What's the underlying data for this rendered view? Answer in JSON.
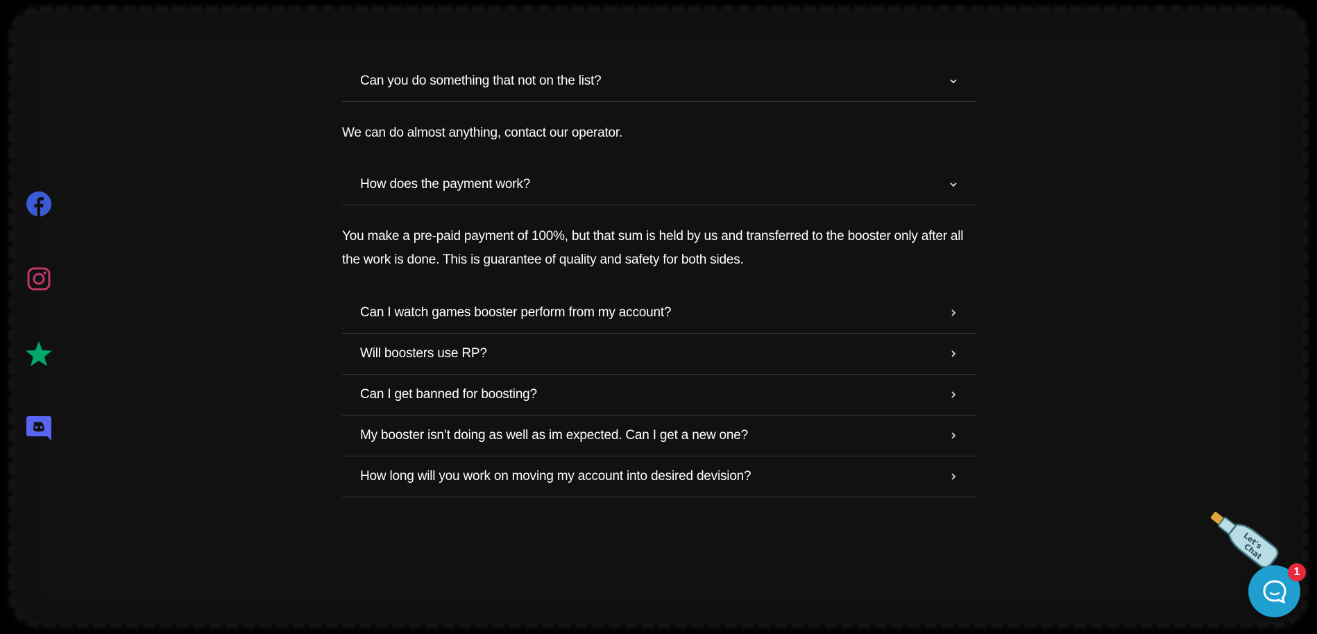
{
  "social": [
    {
      "name": "facebook",
      "icon": "facebook-icon",
      "color": "#3b5bd6"
    },
    {
      "name": "instagram",
      "icon": "instagram-icon",
      "color": "#c2366e"
    },
    {
      "name": "trustpilot",
      "icon": "star-icon",
      "color": "#00a86b"
    },
    {
      "name": "discord",
      "icon": "discord-icon",
      "color": "#5865f2"
    }
  ],
  "faq": {
    "items": [
      {
        "question": "Can you do something that not on the list?",
        "expanded": true,
        "answer": "We can do almost anything, contact our operator."
      },
      {
        "question": "How does the payment work?",
        "expanded": true,
        "answer": "You make a pre-paid payment of 100%, but that sum is held by us and transferred to the booster only after all the work is done. This is guarantee of quality and safety for both sides."
      },
      {
        "question": "Can I watch games booster perform from my account?",
        "expanded": false
      },
      {
        "question": "Will boosters use RP?",
        "expanded": false
      },
      {
        "question": "Can I get banned for boosting?",
        "expanded": false
      },
      {
        "question": "My booster isn’t doing as well as im expected. Can I get a new one?",
        "expanded": false
      },
      {
        "question": "How long will you work on moving my account into desired devision?",
        "expanded": false
      }
    ]
  },
  "chat": {
    "bottle_text": "Let's Chat",
    "badge_count": "1",
    "accent": "#1e9fd0",
    "badge_color": "#e8283c"
  }
}
